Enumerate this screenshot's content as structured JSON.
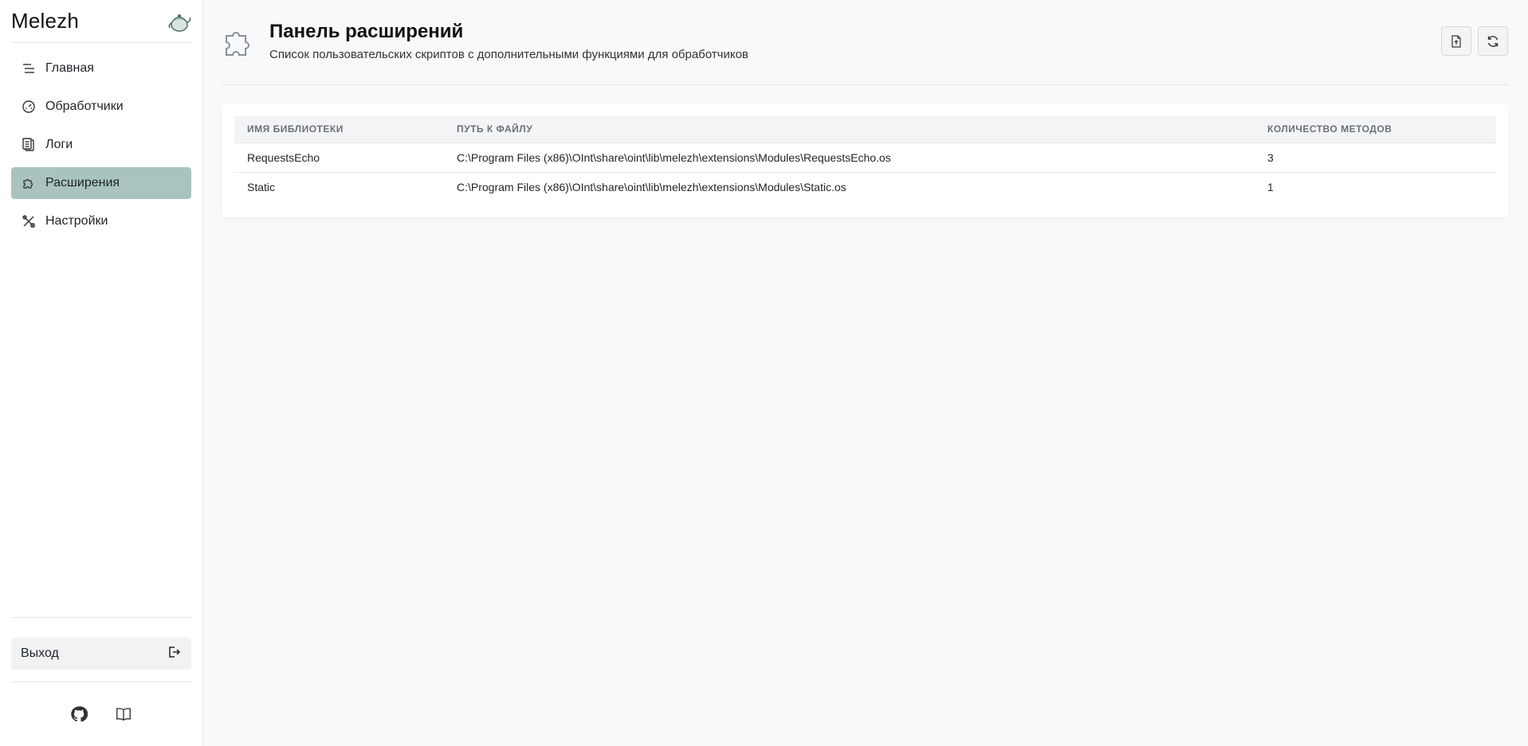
{
  "brand": {
    "title": "Melezh"
  },
  "sidebar": {
    "items": [
      {
        "label": "Главная",
        "icon": "menu-lines-icon"
      },
      {
        "label": "Обработчики",
        "icon": "gauge-icon"
      },
      {
        "label": "Логи",
        "icon": "clipboard-icon"
      },
      {
        "label": "Расширения",
        "icon": "puzzle-icon",
        "active": true
      },
      {
        "label": "Настройки",
        "icon": "tools-icon"
      }
    ],
    "logout_label": "Выход"
  },
  "header": {
    "title": "Панель расширений",
    "subtitle": "Список пользовательских скриптов с дополнительными функциями для обработчиков"
  },
  "table": {
    "columns": [
      "ИМЯ БИБЛИОТЕКИ",
      "ПУТЬ К ФАЙЛУ",
      "КОЛИЧЕСТВО МЕТОДОВ"
    ],
    "rows": [
      {
        "name": "RequestsEcho",
        "path": "C:\\Program Files (x86)\\OInt\\share\\oint\\lib\\melezh\\extensions\\Modules\\RequestsEcho.os",
        "count": "3"
      },
      {
        "name": "Static",
        "path": "C:\\Program Files (x86)\\OInt\\share\\oint\\lib\\melezh\\extensions\\Modules\\Static.os",
        "count": "1"
      }
    ]
  },
  "colors": {
    "accent": "#a9c4bf",
    "background": "#f8f9fb"
  }
}
